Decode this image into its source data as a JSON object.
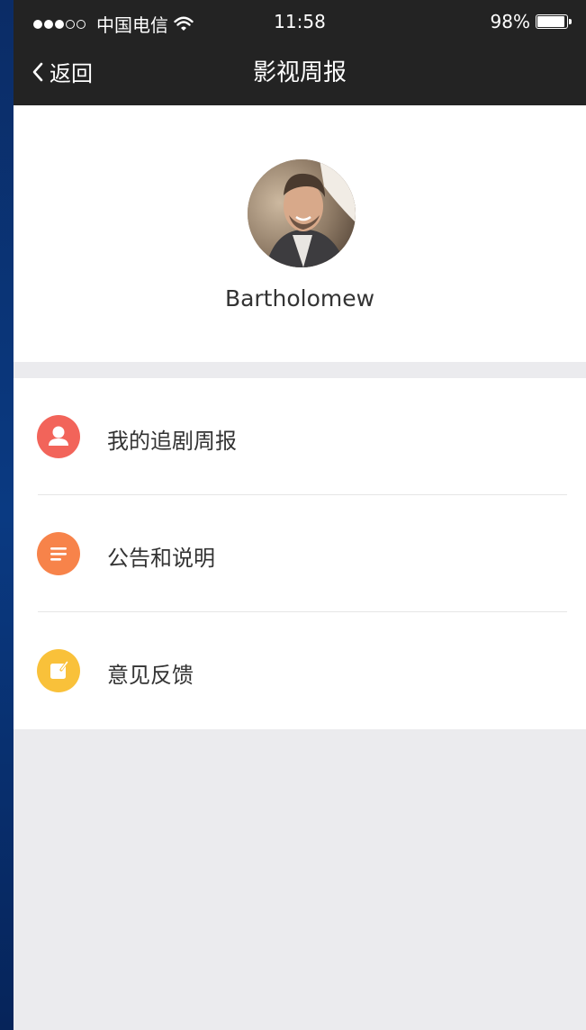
{
  "status_bar": {
    "carrier": "中国电信",
    "time": "11:58",
    "battery_text": "98%",
    "battery_level": 0.98,
    "signal_filled": 3,
    "signal_total": 5
  },
  "nav": {
    "back_label": "返回",
    "title": "影视周报"
  },
  "profile": {
    "username": "Bartholomew"
  },
  "menu": {
    "items": [
      {
        "label": "我的追剧周报",
        "icon": "user-icon",
        "color": "#f2645a"
      },
      {
        "label": "公告和说明",
        "icon": "notice-icon",
        "color": "#f7834a"
      },
      {
        "label": "意见反馈",
        "icon": "feedback-icon",
        "color": "#f9c13a"
      }
    ]
  },
  "colors": {
    "navbar": "#232323",
    "page_bg": "#ebebee",
    "divider": "#e6e6e6"
  }
}
